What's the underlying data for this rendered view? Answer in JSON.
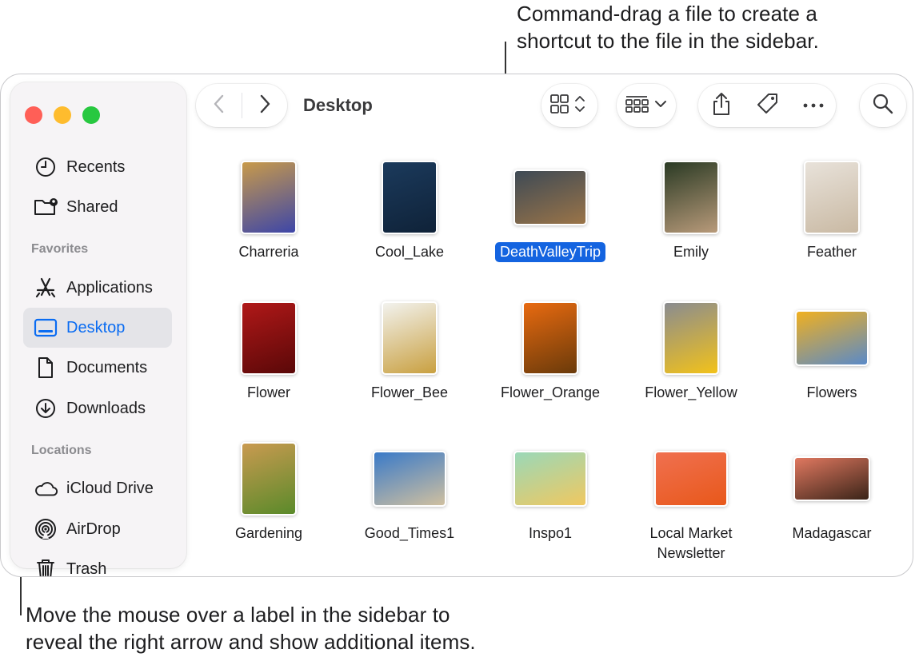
{
  "callouts": {
    "top_line1": "Command-drag a file to create a",
    "top_line2": "shortcut to the file in the sidebar.",
    "bottom_line1": "Move the mouse over a label in the sidebar to",
    "bottom_line2": "reveal the right arrow and show additional items."
  },
  "toolbar": {
    "title": "Desktop",
    "back_icon": "chevron-left",
    "forward_icon": "chevron-right",
    "view_icon": "grid-view",
    "group_icon": "group-by",
    "share_icon": "share",
    "tag_icon": "tag",
    "more_icon": "ellipsis",
    "search_icon": "magnifying-glass"
  },
  "sidebar": {
    "top_items": [
      {
        "label": "Recents",
        "icon": "clock"
      },
      {
        "label": "Shared",
        "icon": "shared-folder"
      }
    ],
    "favorites_heading": "Favorites",
    "favorites": [
      {
        "label": "Applications",
        "icon": "applications"
      },
      {
        "label": "Desktop",
        "icon": "desktop",
        "selected": true
      },
      {
        "label": "Documents",
        "icon": "document"
      },
      {
        "label": "Downloads",
        "icon": "download"
      }
    ],
    "locations_heading": "Locations",
    "locations": [
      {
        "label": "iCloud Drive",
        "icon": "cloud"
      },
      {
        "label": "AirDrop",
        "icon": "airdrop"
      },
      {
        "label": "Trash",
        "icon": "trash"
      }
    ]
  },
  "files": [
    {
      "name": "Charreria",
      "colors": [
        "#c89a4a",
        "#3d46a8"
      ]
    },
    {
      "name": "Cool_Lake",
      "colors": [
        "#1b3a5c",
        "#0f2238"
      ]
    },
    {
      "name": "DeathValleyTrip",
      "selected": true,
      "colors": [
        "#3e4a55",
        "#9a7448"
      ]
    },
    {
      "name": "Emily",
      "colors": [
        "#2a3a24",
        "#b89a7a"
      ]
    },
    {
      "name": "Feather",
      "colors": [
        "#e8e2da",
        "#c9b9a3"
      ]
    },
    {
      "name": "Flower",
      "colors": [
        "#b01818",
        "#5a0808"
      ]
    },
    {
      "name": "Flower_Bee",
      "colors": [
        "#f2f2ee",
        "#c9a040"
      ]
    },
    {
      "name": "Flower_Orange",
      "colors": [
        "#e86a10",
        "#6a3a0a"
      ]
    },
    {
      "name": "Flower_Yellow",
      "colors": [
        "#8a8c90",
        "#f2c21a"
      ]
    },
    {
      "name": "Flowers",
      "colors": [
        "#f0b020",
        "#5a8ac8"
      ]
    },
    {
      "name": "Gardening",
      "colors": [
        "#c99a50",
        "#5a8a2a"
      ]
    },
    {
      "name": "Good_Times1",
      "colors": [
        "#3a7ac8",
        "#d0c0a0"
      ]
    },
    {
      "name": "Inspo1",
      "colors": [
        "#9ad8b8",
        "#f0c860"
      ]
    },
    {
      "name": "Local Market Newsletter",
      "colors": [
        "#f07050",
        "#e8581a"
      ]
    },
    {
      "name": "Madagascar",
      "colors": [
        "#e07860",
        "#3a2418"
      ]
    }
  ]
}
